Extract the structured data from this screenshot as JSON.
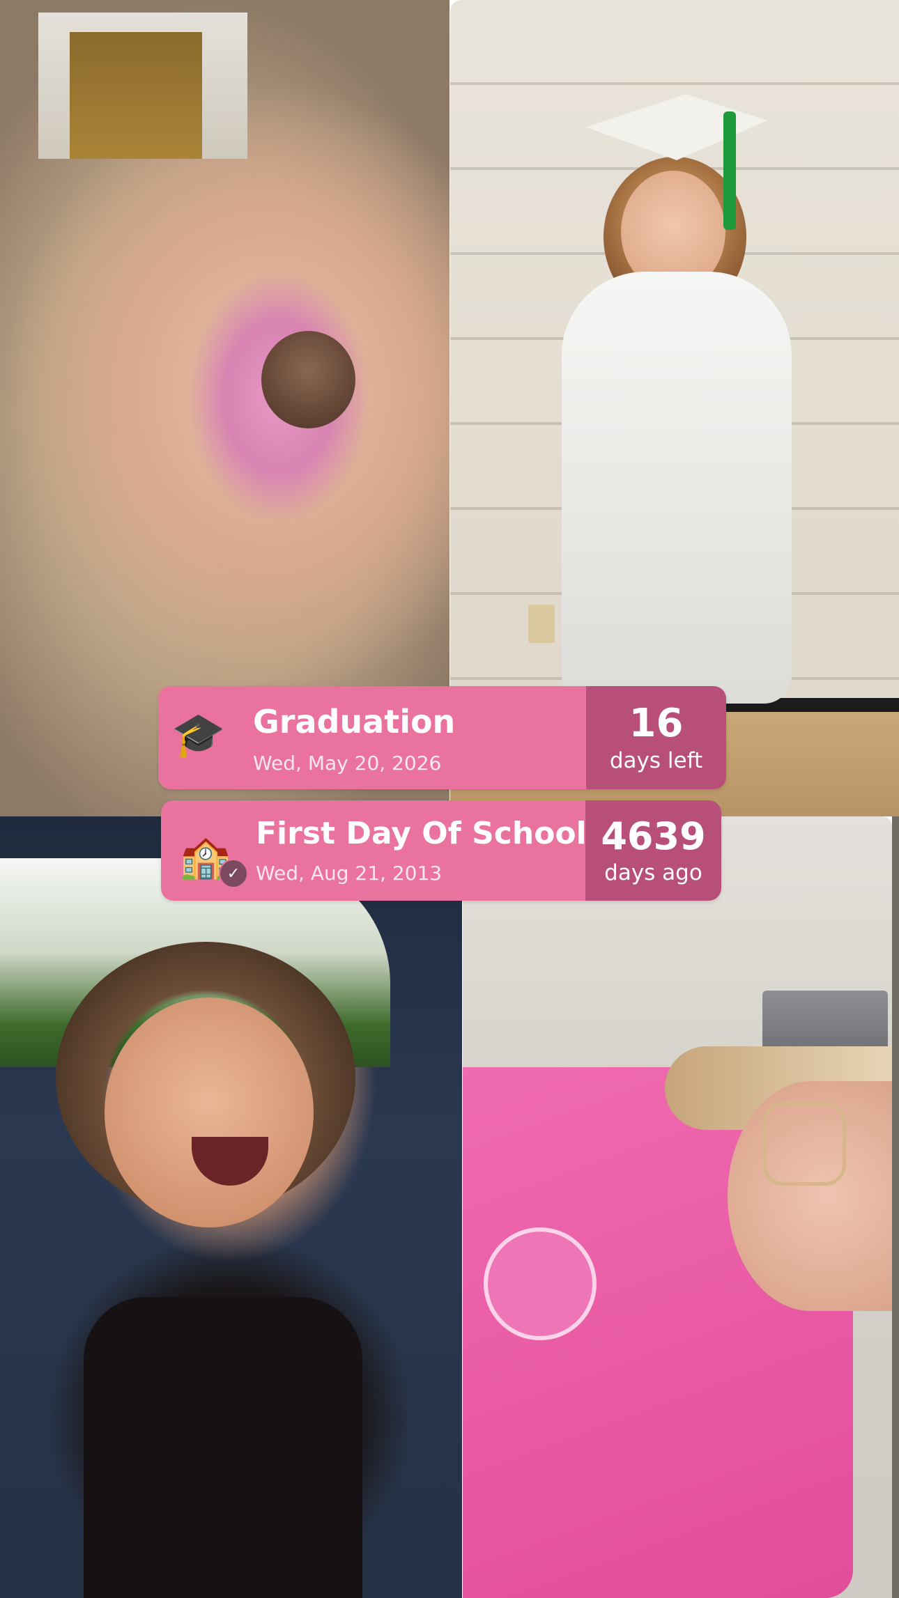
{
  "widgets": [
    {
      "icon": "graduation-cap-icon",
      "icon_glyph": "🎓",
      "title": "Graduation",
      "date": "Wed, May 20, 2026",
      "count": "16",
      "count_label": "days left"
    },
    {
      "icon": "school-building-icon",
      "icon_glyph": "🏫",
      "badge_icon": "checkmark-icon",
      "badge_glyph": "✓",
      "title": "First Day Of School",
      "date": "Wed, Aug 21, 2013",
      "count": "4639",
      "count_label": "days ago"
    }
  ],
  "colors": {
    "widget_main": "#e9729e",
    "widget_count": "#b74f79"
  }
}
